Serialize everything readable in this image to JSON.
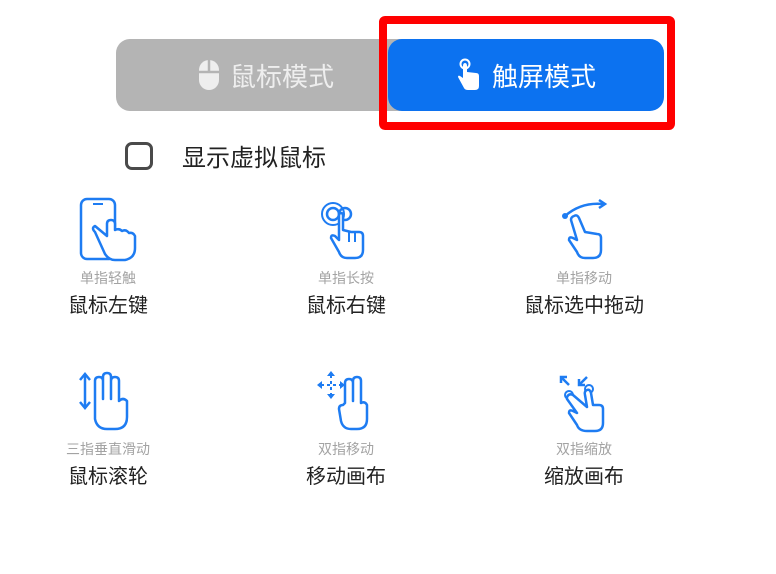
{
  "mode_toggle": {
    "mouse_mode_label": "鼠标模式",
    "touch_mode_label": "触屏模式",
    "selected": "touch"
  },
  "virtual_mouse": {
    "label": "显示虚拟鼠标",
    "checked": false
  },
  "gestures": [
    {
      "gesture": "单指轻触",
      "action": "鼠标左键",
      "icon": "tap-phone-icon"
    },
    {
      "gesture": "单指长按",
      "action": "鼠标右键",
      "icon": "long-press-icon"
    },
    {
      "gesture": "单指移动",
      "action": "鼠标选中拖动",
      "icon": "swipe-drag-icon"
    },
    {
      "gesture": "三指垂直滑动",
      "action": "鼠标滚轮",
      "icon": "three-finger-scroll-icon"
    },
    {
      "gesture": "双指移动",
      "action": "移动画布",
      "icon": "two-finger-move-icon"
    },
    {
      "gesture": "双指缩放",
      "action": "缩放画布",
      "icon": "pinch-zoom-icon"
    }
  ],
  "colors": {
    "accent": "#0c72f0",
    "inactive_button": "#b4b4b4",
    "highlight_border": "#ff0000",
    "icon_blue": "#1e7cf2"
  }
}
